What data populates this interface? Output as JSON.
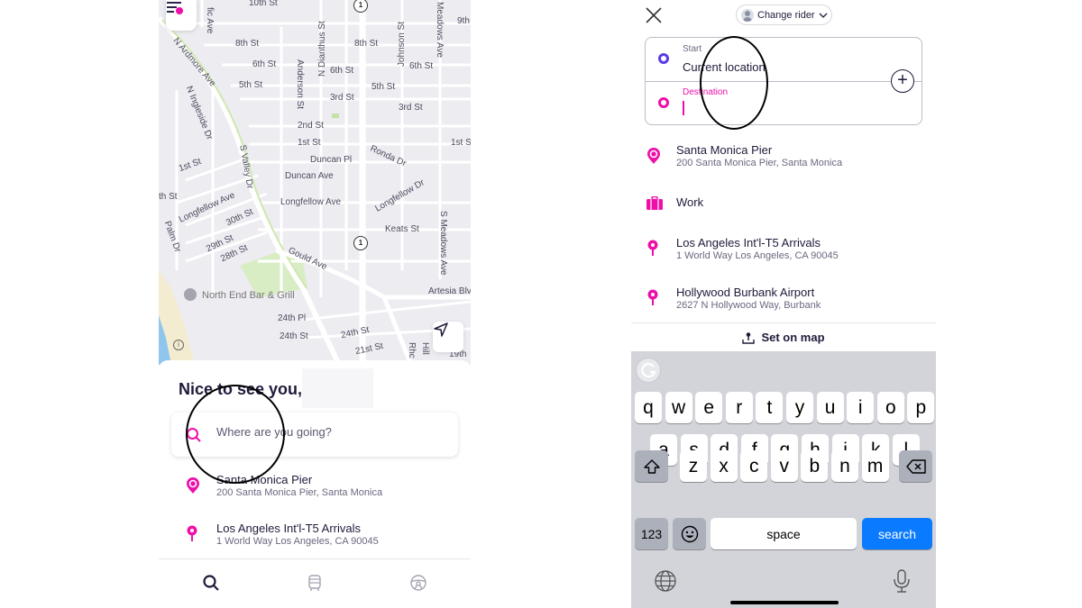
{
  "left_screen": {
    "map": {
      "labels": {
        "l1": "10th St",
        "l2": "fic Ave",
        "l3": "8th St",
        "l4": "8th St",
        "l5": "6th St",
        "l6": "6th St",
        "l7": "6th St",
        "l8": "5th St",
        "l9": "5th St",
        "l10": "3rd St",
        "l11": "3rd St",
        "l12": "2nd St",
        "l13": "1st St",
        "l14": "1st St",
        "l15": "1st St",
        "l16": "Duncan Pl",
        "l17": "Duncan Ave",
        "l18": "Ronda Dr",
        "l19": "Longfellow Ave",
        "l20": "Longfellow Ave",
        "l21": "Longfellow Dr",
        "l22": "Keats St",
        "l23": "30th St",
        "l24": "29th St",
        "l25": "28th St",
        "l26": "Gould Ave",
        "l27": "North End Bar & Grill",
        "l28": "24th Pl",
        "l29": "24th St",
        "l30": "24th St",
        "l31": "21st St",
        "l32": "Artesia Blvd",
        "l33": "N Ardmore Ave",
        "l34": "N Ingleside Dr",
        "l35": "S Valley Dr",
        "l36": "Anderson St",
        "l37": "N Dianthus St",
        "l38": "Johnson St",
        "l39": "Meadows Ave",
        "l40": "S Meadows Ave",
        "l41": "9th",
        "l42": "th St",
        "l43": "Palm Dr",
        "l44": "19th",
        "l45": "Rhc",
        "l46": "Hill"
      },
      "route_shield": "1",
      "info_icon": "i"
    },
    "greeting": "Nice to see you,",
    "search": {
      "placeholder": "Where are you going?"
    },
    "recent_places": [
      {
        "title": "Santa Monica Pier",
        "subtitle": "200 Santa Monica Pier, Santa Monica",
        "icon": "landmark-pin-icon"
      },
      {
        "title": "Los Angeles Int'l-T5 Arrivals",
        "subtitle": "1 World Way Los Angeles, CA 90045",
        "icon": "location-pin-icon"
      }
    ],
    "bottom_nav": [
      {
        "name": "search-tab",
        "icon": "search-icon",
        "active": true
      },
      {
        "name": "transit-tab",
        "icon": "bus-icon",
        "active": false
      },
      {
        "name": "drive-tab",
        "icon": "steering-wheel-icon",
        "active": false
      }
    ]
  },
  "right_screen": {
    "change_rider_label": "Change rider",
    "route": {
      "start_label": "Start",
      "start_value": "Current location",
      "destination_label": "Destination",
      "destination_value": ""
    },
    "suggestions": [
      {
        "title": "Santa Monica Pier",
        "subtitle": "200 Santa Monica Pier, Santa Monica",
        "icon": "landmark-pin-icon"
      },
      {
        "title": "Work",
        "subtitle": "",
        "icon": "briefcase-icon"
      },
      {
        "title": "Los Angeles Int'l-T5 Arrivals",
        "subtitle": "1 World Way Los Angeles, CA 90045",
        "icon": "location-pin-icon"
      },
      {
        "title": "Hollywood Burbank Airport",
        "subtitle": "2627 N Hollywood Way, Burbank",
        "icon": "location-pin-icon"
      }
    ],
    "set_on_map_label": "Set on map",
    "keyboard": {
      "row1": [
        "q",
        "w",
        "e",
        "r",
        "t",
        "y",
        "u",
        "i",
        "o",
        "p"
      ],
      "row2": [
        "a",
        "s",
        "d",
        "f",
        "g",
        "h",
        "j",
        "k",
        "l"
      ],
      "row3": [
        "z",
        "x",
        "c",
        "v",
        "b",
        "n",
        "m"
      ],
      "numbers_label": "123",
      "space_label": "space",
      "search_label": "search"
    }
  },
  "colors": {
    "brand_pink": "#ee0fa8",
    "start_purple": "#5b3ce8",
    "text_dark": "#1e1b3a",
    "keyboard_blue": "#0a7bff"
  }
}
